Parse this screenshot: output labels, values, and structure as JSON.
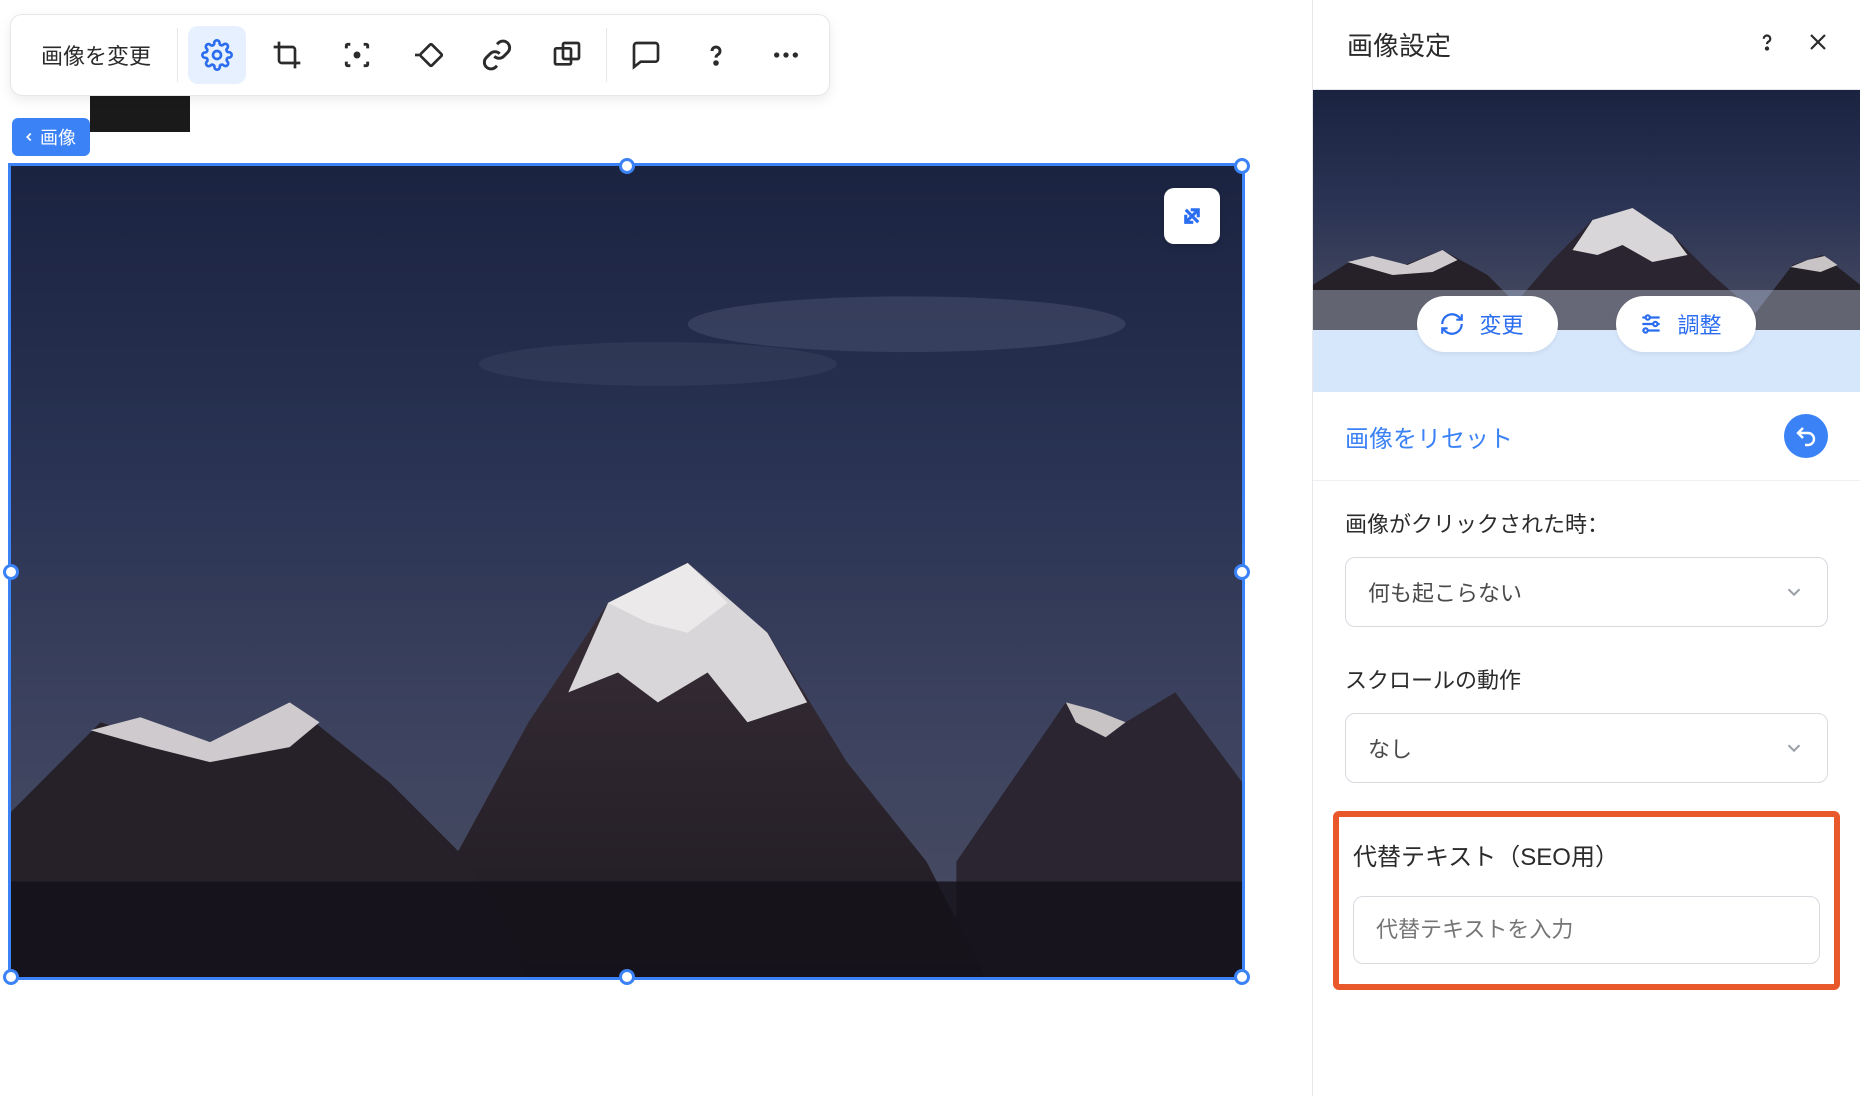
{
  "toolbar": {
    "change_image": "画像を変更"
  },
  "back_badge": "画像",
  "expand_tooltip": "expand",
  "sidebar": {
    "title": "画像設定",
    "change_label": "変更",
    "adjust_label": "調整",
    "reset_link": "画像をリセット",
    "click_section": {
      "label": "画像がクリックされた時：",
      "value": "何も起こらない"
    },
    "scroll_section": {
      "label": "スクロールの動作",
      "value": "なし"
    },
    "alt_section": {
      "label": "代替テキスト（SEO用）",
      "placeholder": "代替テキストを入力"
    }
  }
}
